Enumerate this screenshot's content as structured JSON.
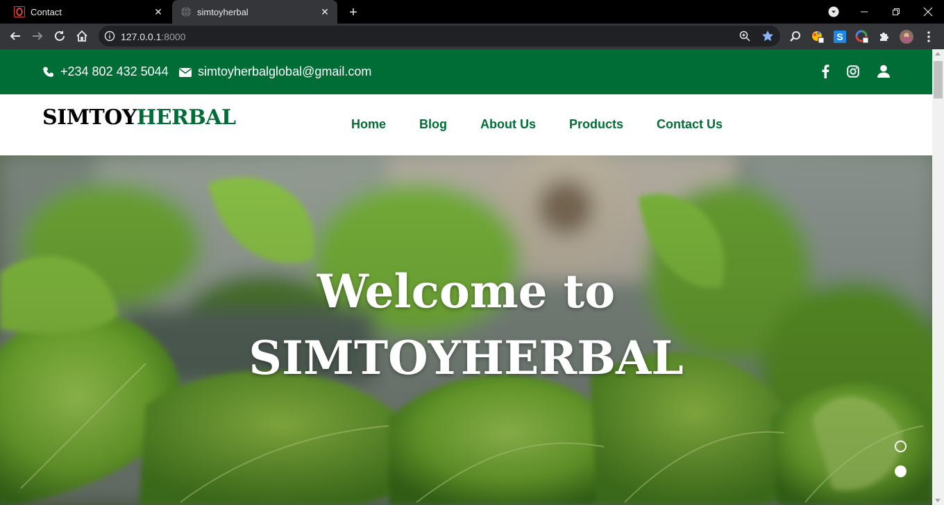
{
  "browser": {
    "tabs": [
      {
        "title": "Contact",
        "active": false
      },
      {
        "title": "simtoyherbal",
        "active": true
      }
    ],
    "url_host": "127.0.0.1",
    "url_port": ":8000"
  },
  "topbar": {
    "phone": "+234 802 432 5044",
    "email": "simtoyherbalglobal@gmail.com",
    "social_icons": [
      "facebook-icon",
      "instagram-icon",
      "user-icon"
    ],
    "color": "#006d36"
  },
  "header": {
    "logo_part1": "SIMTOY",
    "logo_part2": "HERBAL",
    "nav": [
      "Home",
      "Blog",
      "About Us",
      "Products",
      "Contact Us"
    ]
  },
  "hero": {
    "title_line1": "Welcome to",
    "title_line2": "SIMTOYHERBAL",
    "carousel_slides": 2,
    "active_slide": 2
  }
}
